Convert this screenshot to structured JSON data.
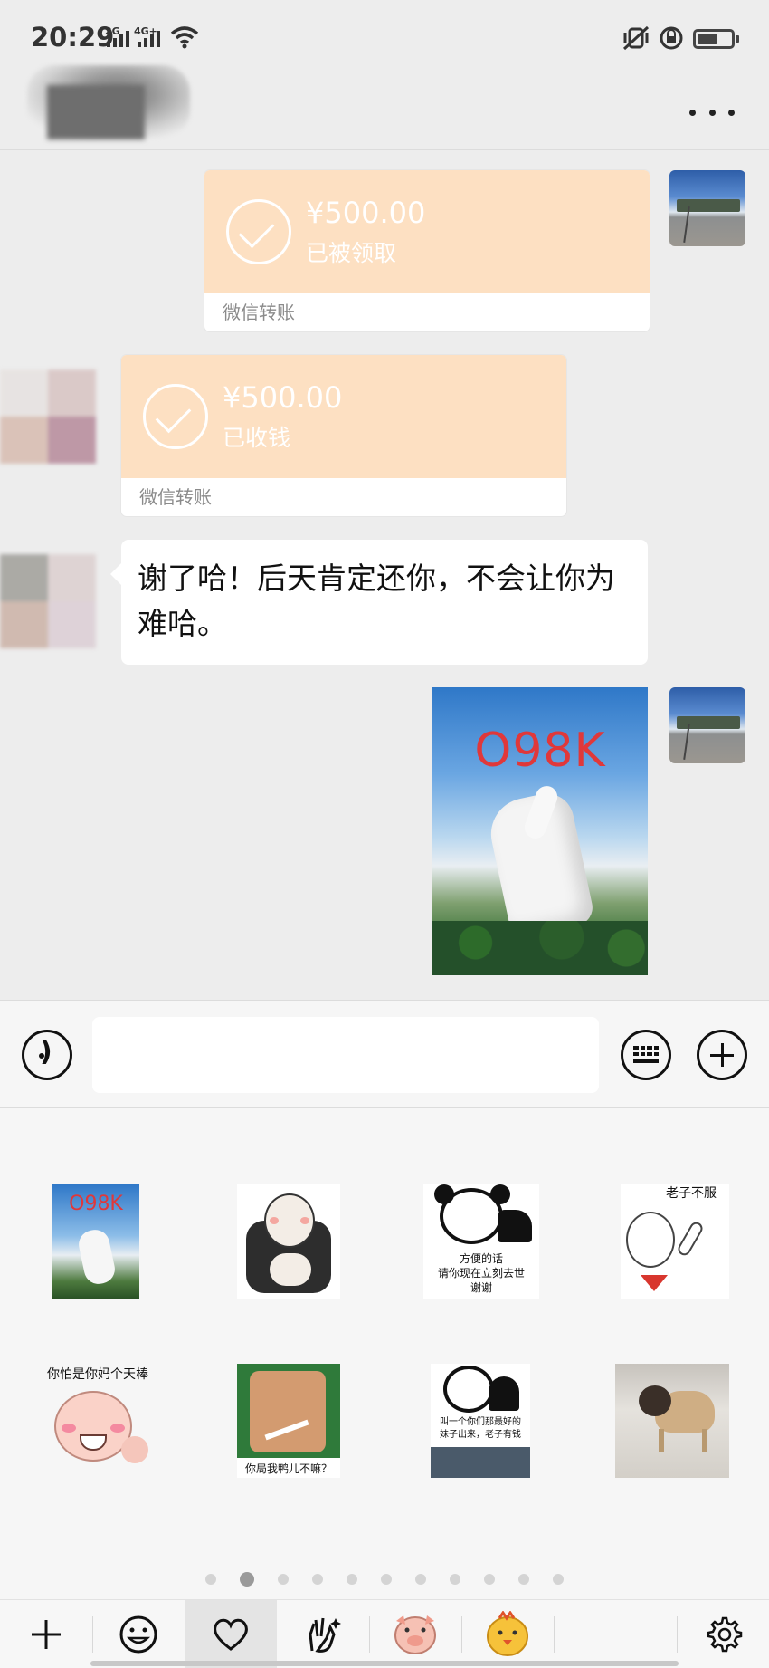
{
  "status_bar": {
    "time": "20:29",
    "network_1": "2G",
    "network_2": "4G+"
  },
  "messages": {
    "transfer_sent": {
      "amount": "¥500.00",
      "status": "已被领取",
      "footer": "微信转账"
    },
    "transfer_received": {
      "amount": "¥500.00",
      "status": "已收钱",
      "footer": "微信转账"
    },
    "text_message": "谢了哈！后天肯定还你，不会让你为难哈。",
    "image_caption": "O98K"
  },
  "input": {
    "value": "",
    "placeholder": ""
  },
  "stickers": {
    "s1_caption": "O98K",
    "s4_caption": "老子不服",
    "s3_caption_1": "方便的话",
    "s3_caption_2": "请你现在立刻去世",
    "s3_caption_3": "谢谢",
    "s5_caption": "你怕是你妈个天棒",
    "s6_caption": "你局我鸭儿不嘛？",
    "s7_caption_1": "叫一个你们那最好的",
    "s7_caption_2": "妹子出来，老子有钱"
  },
  "pager": {
    "total": 11,
    "current": 1
  },
  "icons": {
    "more": "more-dots-icon",
    "voice": "voice-icon",
    "keyboard": "keyboard-icon",
    "plus": "plus-icon",
    "add": "add-icon",
    "emoji": "emoji-icon",
    "favorite": "heart-icon",
    "custom": "gesture-icon",
    "settings": "gear-icon"
  },
  "colors": {
    "transfer_bg": "#fde0c2",
    "chat_bg": "#ededed",
    "image_label": "#e0383a"
  }
}
